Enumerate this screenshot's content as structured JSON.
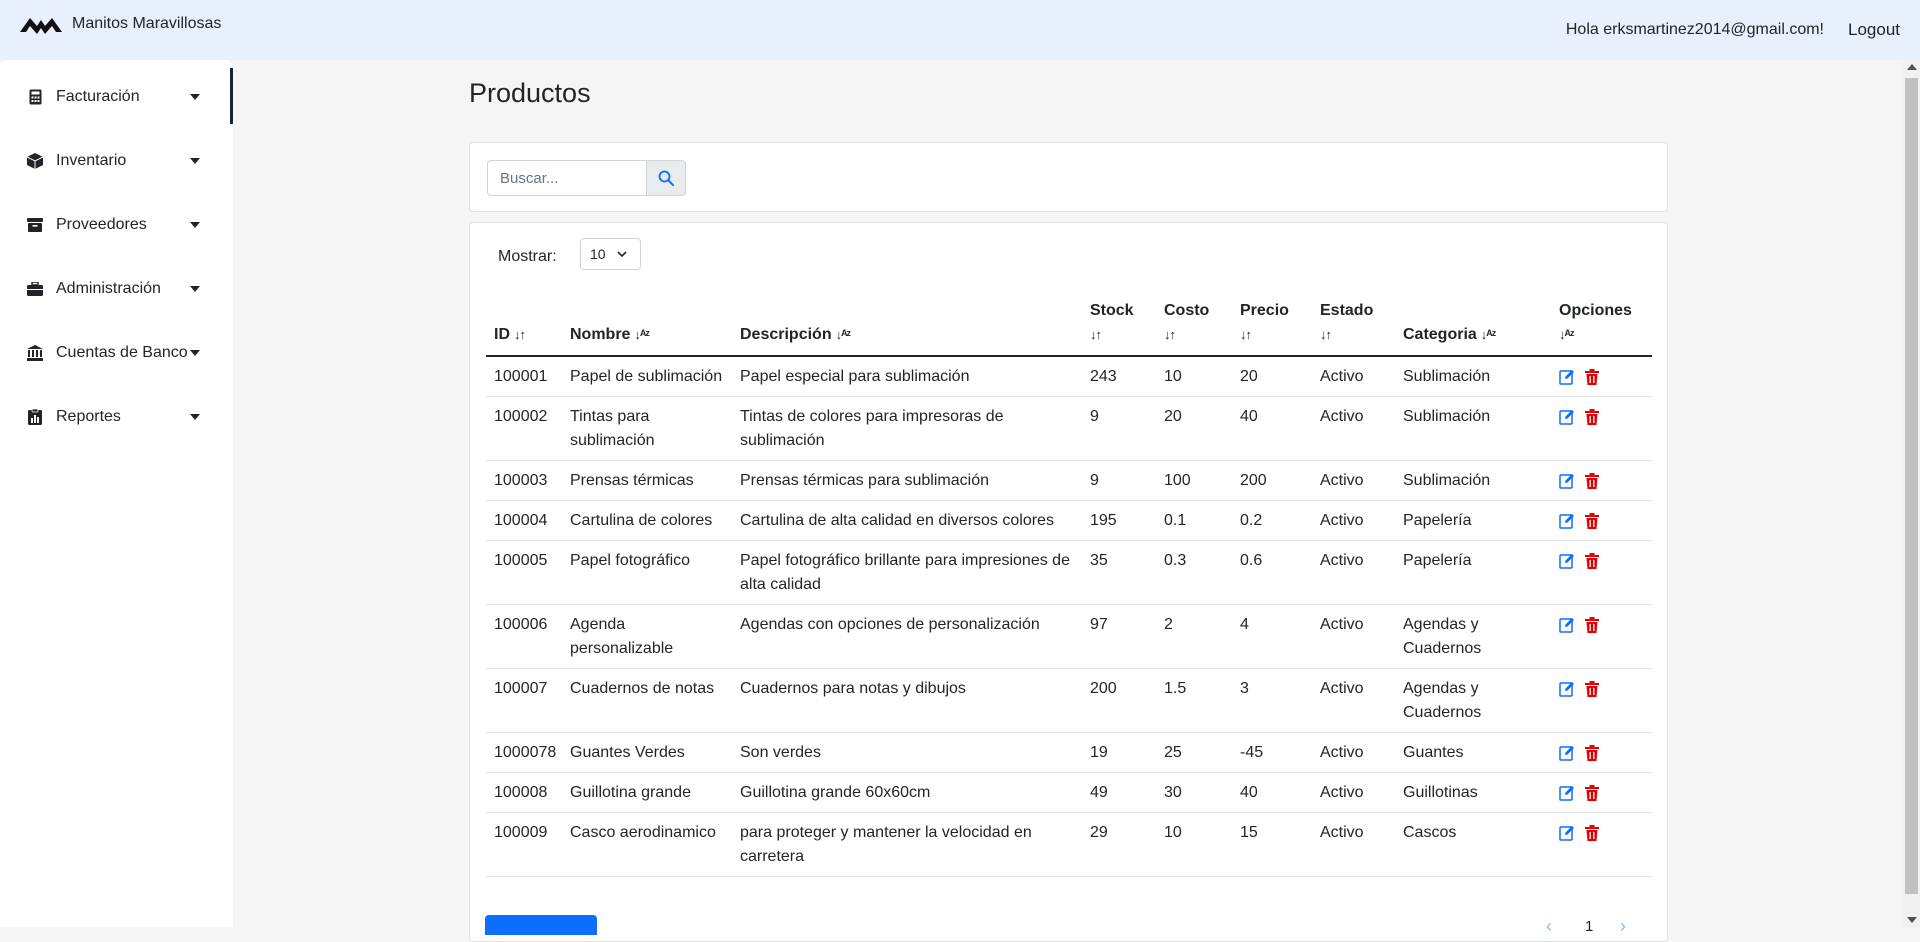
{
  "app": {
    "name": "Manitos Maravillosas"
  },
  "header": {
    "greeting": "Hola erksmartinez2014@gmail.com!",
    "logout": "Logout"
  },
  "sidebar": {
    "items": [
      {
        "label": "Facturación",
        "icon": "calculator-icon"
      },
      {
        "label": "Inventario",
        "icon": "box-icon"
      },
      {
        "label": "Proveedores",
        "icon": "archive-icon"
      },
      {
        "label": "Administración",
        "icon": "briefcase-icon"
      },
      {
        "label": "Cuentas de Banco",
        "icon": "bank-icon"
      },
      {
        "label": "Reportes",
        "icon": "report-icon"
      }
    ]
  },
  "main": {
    "title": "Productos",
    "search": {
      "placeholder": "Buscar..."
    },
    "show": {
      "label": "Mostrar:",
      "value": "10"
    },
    "table": {
      "columns": [
        {
          "label": "ID",
          "sort": "↓↑"
        },
        {
          "label": "Nombre",
          "sort": "↓ᴬᶻ"
        },
        {
          "label": "Descripción",
          "sort": "↓ᴬᶻ"
        },
        {
          "label": "Stock",
          "sort": "↓↑"
        },
        {
          "label": "Costo",
          "sort": "↓↑"
        },
        {
          "label": "Precio",
          "sort": "↓↑"
        },
        {
          "label": "Estado",
          "sort": "↓↑"
        },
        {
          "label": "Categoria",
          "sort": "↓ᴬᶻ"
        },
        {
          "label": "Opciones",
          "sort": "↓ᴬᶻ"
        }
      ],
      "rows": [
        [
          "100001",
          "Papel de sublimación",
          "Papel especial para sublimación",
          "243",
          "10",
          "20",
          "Activo",
          "Sublimación"
        ],
        [
          "100002",
          "Tintas para sublimación",
          "Tintas de colores para impresoras de sublimación",
          "9",
          "20",
          "40",
          "Activo",
          "Sublimación"
        ],
        [
          "100003",
          "Prensas térmicas",
          "Prensas térmicas para sublimación",
          "9",
          "100",
          "200",
          "Activo",
          "Sublimación"
        ],
        [
          "100004",
          "Cartulina de colores",
          "Cartulina de alta calidad en diversos colores",
          "195",
          "0.1",
          "0.2",
          "Activo",
          "Papelería"
        ],
        [
          "100005",
          "Papel fotográfico",
          "Papel fotográfico brillante para impresiones de alta calidad",
          "35",
          "0.3",
          "0.6",
          "Activo",
          "Papelería"
        ],
        [
          "100006",
          "Agenda personalizable",
          "Agendas con opciones de personalización",
          "97",
          "2",
          "4",
          "Activo",
          "Agendas y Cuadernos"
        ],
        [
          "100007",
          "Cuadernos de notas",
          "Cuadernos para notas y dibujos",
          "200",
          "1.5",
          "3",
          "Activo",
          "Agendas y Cuadernos"
        ],
        [
          "1000078",
          "Guantes Verdes",
          "Son verdes",
          "19",
          "25",
          "-45",
          "Activo",
          "Guantes"
        ],
        [
          "100008",
          "Guillotina grande",
          "Guillotina grande 60x60cm",
          "49",
          "30",
          "40",
          "Activo",
          "Guillotinas"
        ],
        [
          "100009",
          "Casco aerodinamico",
          "para proteger y mantener la velocidad en carretera",
          "29",
          "10",
          "15",
          "Activo",
          "Cascos"
        ]
      ]
    },
    "pagination": {
      "prev": "‹",
      "current": "1",
      "next": "›"
    }
  },
  "colors": {
    "primary": "#0d6efd",
    "danger": "#dc3545",
    "topbar": "#e8f0fe"
  }
}
